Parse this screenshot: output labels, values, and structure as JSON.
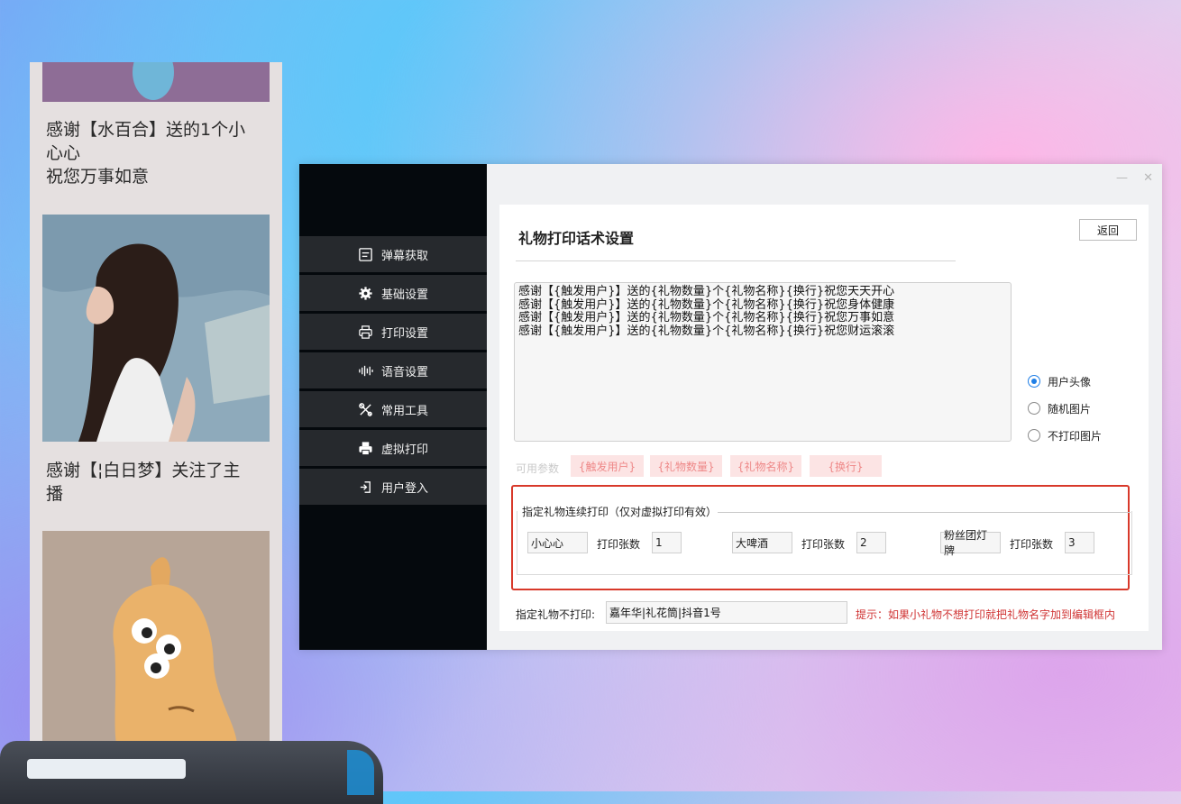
{
  "preview": {
    "message_1": "感谢【水百合】送的1个小\n心心\n祝您万事如意",
    "message_2": "感谢【¦白日梦】关注了主\n播"
  },
  "window": {
    "minimize_glyph": "—",
    "close_glyph": "✕"
  },
  "sidebar": {
    "items": [
      {
        "label": "弹幕获取",
        "icon": "danmaku-icon"
      },
      {
        "label": "基础设置",
        "icon": "gear-icon"
      },
      {
        "label": "打印设置",
        "icon": "printer-icon"
      },
      {
        "label": "语音设置",
        "icon": "audio-wave-icon"
      },
      {
        "label": "常用工具",
        "icon": "tools-icon"
      },
      {
        "label": "虚拟打印",
        "icon": "virtual-printer-icon"
      },
      {
        "label": "用户登入",
        "icon": "login-icon"
      }
    ]
  },
  "panel": {
    "title": "礼物打印话术设置",
    "back_label": "返回",
    "template_text": "感谢【{触发用户}】送的{礼物数量}个{礼物名称}{换行}祝您天天开心\n感谢【{触发用户}】送的{礼物数量}个{礼物名称}{换行}祝您身体健康\n感谢【{触发用户}】送的{礼物数量}个{礼物名称}{换行}祝您万事如意\n感谢【{触发用户}】送的{礼物数量}个{礼物名称}{换行}祝您财运滚滚",
    "image_options": [
      {
        "label": "用户头像",
        "checked": true
      },
      {
        "label": "随机图片",
        "checked": false
      },
      {
        "label": "不打印图片",
        "checked": false
      }
    ],
    "params_label": "可用参数",
    "params": [
      "{触发用户}",
      "{礼物数量}",
      "{礼物名称}",
      "{换行}"
    ],
    "continuous": {
      "legend": "指定礼物连续打印（仅对虚拟打印有效）",
      "count_label": "打印张数",
      "gifts": [
        {
          "name": "小心心",
          "count": "1"
        },
        {
          "name": "大啤酒",
          "count": "2"
        },
        {
          "name": "粉丝团灯牌",
          "count": "3"
        }
      ]
    },
    "no_print_label": "指定礼物不打印:",
    "no_print_value": "嘉年华|礼花筒|抖音1号",
    "hint": "提示：如果小礼物不想打印就把礼物名字加到编辑框内"
  },
  "colors": {
    "sidebar_bg": "#05090d",
    "nav_item_bg": "#26292d",
    "highlight_frame": "#d8392a",
    "radio_accent": "#1e7ee6",
    "hint_text": "#d03434"
  }
}
